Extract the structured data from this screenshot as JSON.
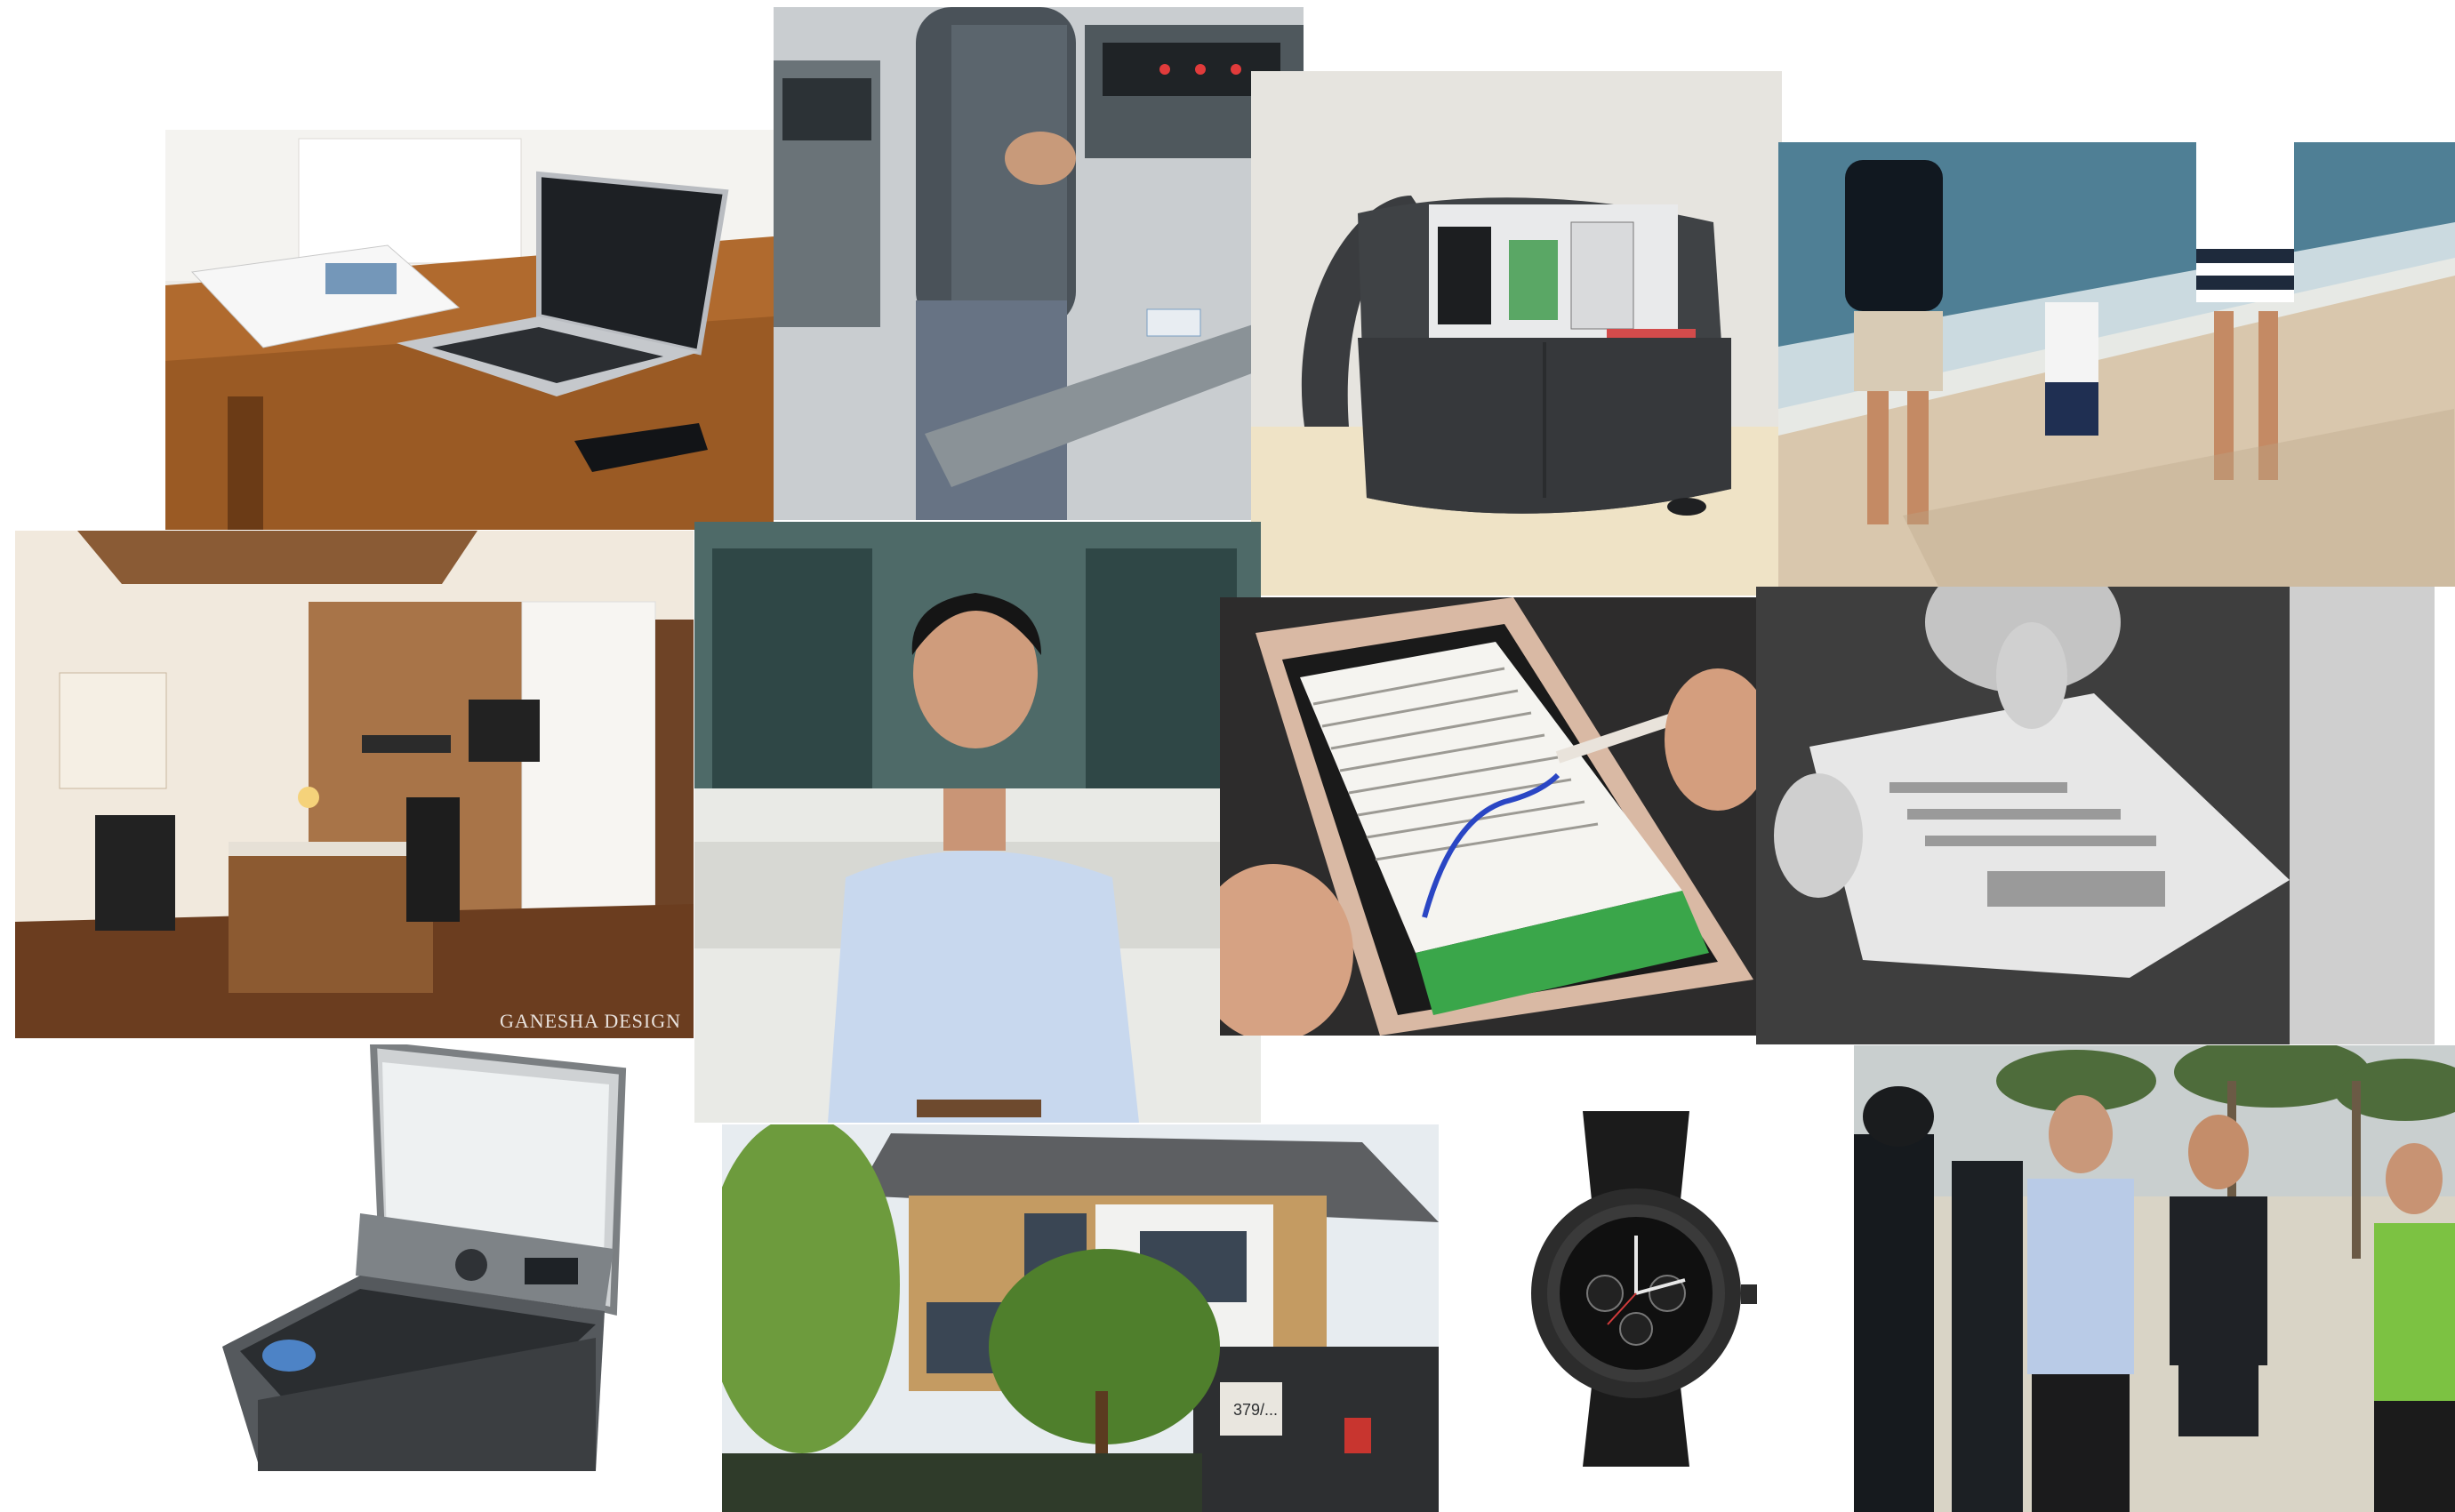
{
  "collage": {
    "tiles": [
      {
        "key": "laptop-desk",
        "subject": "laptop on wooden desk with magazine and smartphone"
      },
      {
        "key": "treadmill",
        "subject": "person running on treadmill"
      },
      {
        "key": "messenger-bag",
        "subject": "grey messenger bag holding tablet and devices"
      },
      {
        "key": "beach-family",
        "subject": "family walking on beach"
      },
      {
        "key": "home-office",
        "subject": "home office interior"
      },
      {
        "key": "portrait-man",
        "subject": "smiling man in light blue shirt"
      },
      {
        "key": "phone-stylus",
        "subject": "smartphone with stylus handwriting"
      },
      {
        "key": "newspaper",
        "subject": "person reading newspaper, black and white"
      },
      {
        "key": "washing-machine",
        "subject": "top-loading washing machine"
      },
      {
        "key": "two-storey-house",
        "subject": "modern two-storey house"
      },
      {
        "key": "wristwatch",
        "subject": "black chronograph wristwatch"
      },
      {
        "key": "street-group",
        "subject": "group of people talking outdoors"
      }
    ],
    "watermark": "GANESHA DESIGN",
    "house_plate": "379/..."
  },
  "colors": {
    "background": "#ffffff",
    "wood": "#b06a2e",
    "sea": "#4f7f95",
    "sand": "#d9c7ad",
    "shirt_blue": "#c8d8ee",
    "green_vest": "#7cc242"
  }
}
